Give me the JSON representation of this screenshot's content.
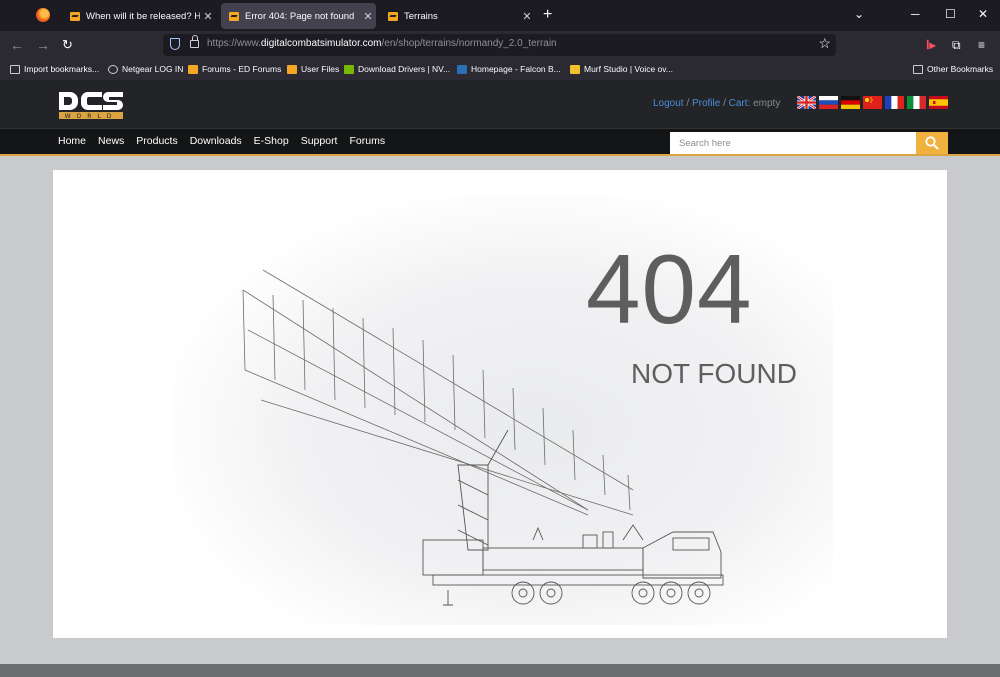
{
  "browser": {
    "tabs": [
      {
        "title": "When will it be released? Hopef",
        "active": false
      },
      {
        "title": "Error 404: Page not found",
        "active": true
      },
      {
        "title": "Terrains",
        "active": false
      }
    ],
    "url": {
      "prefix": "https://www.",
      "host": "digitalcombatsimulator.com",
      "path": "/en/shop/terrains/normandy_2.0_terrain"
    },
    "bookmarks": [
      {
        "label": "Import bookmarks...",
        "icon": "import-icon"
      },
      {
        "label": "Netgear LOG IN",
        "icon": "globe-icon"
      },
      {
        "label": "Forums - ED Forums",
        "icon": "dcs-favicon"
      },
      {
        "label": "User Files",
        "icon": "dcs-favicon"
      },
      {
        "label": "Download Drivers | NV...",
        "icon": "nvidia-icon"
      },
      {
        "label": "Homepage - Falcon B...",
        "icon": "falcon-icon"
      },
      {
        "label": "Murf Studio | Voice ov...",
        "icon": "murf-icon"
      }
    ],
    "other_bookmarks": "Other Bookmarks"
  },
  "site": {
    "logo_text": "DCS",
    "logo_sub": "WORLD",
    "account": {
      "logout": "Logout",
      "profile": "Profile",
      "cart_label": "Cart:",
      "cart_value": "empty",
      "separator": "/"
    },
    "languages": [
      "English",
      "Russian",
      "German",
      "Chinese",
      "French",
      "Italian",
      "Spanish"
    ],
    "menu": [
      "Home",
      "News",
      "Products",
      "Downloads",
      "E-Shop",
      "Support",
      "Forums"
    ],
    "search_placeholder": "Search here"
  },
  "error": {
    "code": "404",
    "message": "NOT FOUND"
  },
  "colors": {
    "accent": "#f0b13f",
    "link": "#4b8fd8",
    "error_text": "#5e5e5e"
  }
}
